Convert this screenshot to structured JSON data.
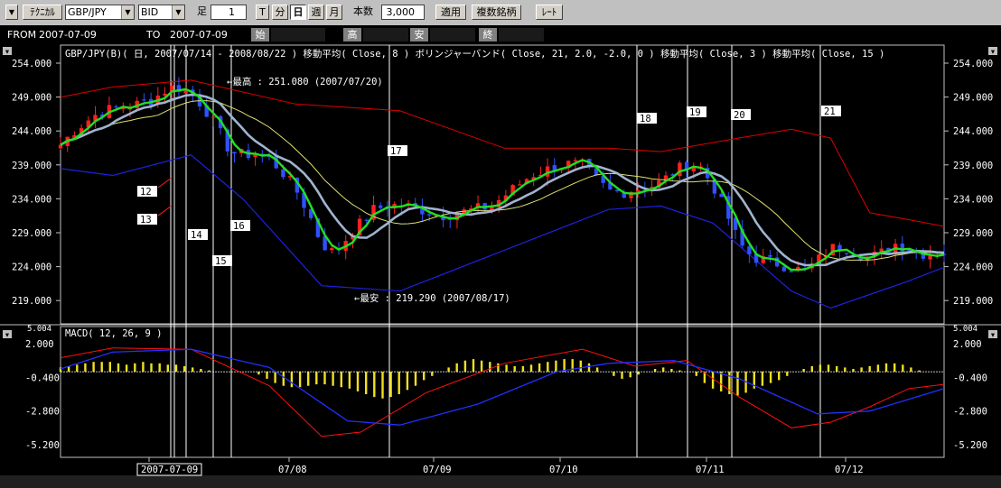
{
  "toolbar": {
    "menu_arrow": "▼",
    "technical_label": "ﾃｸﾆｶﾙ",
    "pair": "GBP/JPY",
    "price_type": "BID",
    "foot_label": "足",
    "foot_value": "1",
    "period_buttons": [
      "T",
      "分",
      "日",
      "週",
      "月"
    ],
    "active_period": "日",
    "count_label": "本数",
    "count_value": "3,000",
    "apply_label": "適用",
    "multi_label": "複数銘柄",
    "rate_label": "ﾚｰﾄ"
  },
  "infobar": {
    "from_label": "FROM",
    "from_value": "2007-07-09",
    "to_label": "TO",
    "to_value": "2007-07-09",
    "open_label": "始",
    "high_label": "高",
    "low_label": "安",
    "close_label": "終"
  },
  "price_panel": {
    "header": "GBP/JPY(B)( 日, 2007/07/14 - 2008/08/22 )   移動平均( Close, 8 )   ボリンジャーバンド( Close, 21, 2.0, -2.0, 0 )   移動平均( Close, 3 )   移動平均( Close, 15 )",
    "high_annotation": "←最高 : 251.080 (2007/07/20)",
    "low_annotation": "←最安 : 219.290 (2007/08/17)",
    "y_ticks": [
      "254.000",
      "249.000",
      "244.000",
      "239.000",
      "234.000",
      "229.000",
      "224.000",
      "219.000"
    ]
  },
  "macd_panel": {
    "header": "MACD( 12, 26, 9 )",
    "y_ticks": [
      "2.000",
      "-0.400",
      "-2.800",
      "-5.200"
    ],
    "cut_tick": "5.004"
  },
  "markers": [
    "12",
    "13",
    "14",
    "15",
    "16",
    "17",
    "18",
    "19",
    "20",
    "21"
  ],
  "x_axis": {
    "labels": [
      "2007-07-09",
      "07/08",
      "07/09",
      "07/10",
      "07/11",
      "07/12"
    ]
  },
  "colors": {
    "up": "#ff2020",
    "down": "#3050ff",
    "ma3": "#20e020",
    "ma8": "#a0b4d0",
    "ma15": "#e0e070",
    "bb_upper": "#e00000",
    "bb_lower": "#2020e0",
    "macd_hist": "#f0e020"
  },
  "chart_data": {
    "type": "candlestick",
    "title": "GBP/JPY(B)( 日, 2007/07/14 - 2008/08/22 )",
    "ylim": [
      216.5,
      256
    ],
    "indicators": [
      "移動平均( Close, 8 )",
      "ボリンジャーバンド( Close, 21, 2.0, -2.0, 0 )",
      "移動平均( Close, 3 )",
      "移動平均( Close, 15 )",
      "MACD( 12, 26, 9 )"
    ],
    "price_path": [
      [
        0,
        242.0
      ],
      [
        10,
        244.0
      ],
      [
        20,
        245.5
      ],
      [
        30,
        246.8
      ],
      [
        40,
        247.3
      ],
      [
        50,
        247.6
      ],
      [
        60,
        248.0
      ],
      [
        70,
        248.6
      ],
      [
        80,
        250.0
      ],
      [
        88,
        250.6
      ],
      [
        100,
        249.6
      ],
      [
        110,
        247.5
      ],
      [
        120,
        244.5
      ],
      [
        130,
        241.0
      ],
      [
        140,
        240.5
      ],
      [
        150,
        240.8
      ],
      [
        160,
        240.0
      ],
      [
        170,
        238.0
      ],
      [
        180,
        235.5
      ],
      [
        190,
        232.0
      ],
      [
        200,
        227.5
      ],
      [
        210,
        226.0
      ],
      [
        220,
        228.5
      ],
      [
        230,
        230.5
      ],
      [
        240,
        232.5
      ],
      [
        250,
        233.0
      ],
      [
        260,
        233.2
      ],
      [
        270,
        232.8
      ],
      [
        280,
        232.3
      ],
      [
        290,
        231.6
      ],
      [
        300,
        231.8
      ],
      [
        310,
        232.2
      ],
      [
        320,
        232.6
      ],
      [
        330,
        233.0
      ],
      [
        340,
        234.5
      ],
      [
        350,
        236.0
      ],
      [
        360,
        237.5
      ],
      [
        370,
        238.2
      ],
      [
        380,
        238.8
      ],
      [
        390,
        239.2
      ],
      [
        400,
        239.0
      ],
      [
        410,
        237.0
      ],
      [
        420,
        235.2
      ],
      [
        430,
        235.0
      ],
      [
        440,
        235.5
      ],
      [
        450,
        235.8
      ],
      [
        460,
        236.5
      ],
      [
        470,
        238.0
      ],
      [
        480,
        239.2
      ],
      [
        490,
        238.8
      ],
      [
        500,
        236.0
      ],
      [
        510,
        232.0
      ],
      [
        520,
        227.5
      ],
      [
        530,
        225.5
      ],
      [
        540,
        225.0
      ],
      [
        550,
        224.5
      ],
      [
        560,
        224.0
      ],
      [
        570,
        223.3
      ],
      [
        580,
        225.0
      ],
      [
        590,
        226.8
      ],
      [
        600,
        227.0
      ],
      [
        610,
        226.0
      ],
      [
        620,
        225.4
      ],
      [
        630,
        226.2
      ],
      [
        640,
        227.5
      ],
      [
        650,
        226.8
      ],
      [
        660,
        226.0
      ],
      [
        670,
        226.3
      ],
      [
        677,
        226.2
      ]
    ],
    "bb_upper": [
      [
        0,
        249
      ],
      [
        40,
        250.5
      ],
      [
        100,
        251.5
      ],
      [
        180,
        248
      ],
      [
        260,
        247
      ],
      [
        340,
        241.5
      ],
      [
        420,
        241.5
      ],
      [
        460,
        241
      ],
      [
        520,
        243
      ],
      [
        560,
        244.3
      ],
      [
        590,
        243
      ],
      [
        620,
        232
      ],
      [
        650,
        231
      ],
      [
        677,
        230
      ]
    ],
    "bb_lower": [
      [
        0,
        238.5
      ],
      [
        40,
        237.5
      ],
      [
        100,
        240.5
      ],
      [
        140,
        234
      ],
      [
        200,
        221.3
      ],
      [
        260,
        220.5
      ],
      [
        340,
        226.5
      ],
      [
        420,
        232.5
      ],
      [
        460,
        233
      ],
      [
        500,
        230.5
      ],
      [
        560,
        220.5
      ],
      [
        590,
        218
      ],
      [
        620,
        220
      ],
      [
        650,
        222
      ],
      [
        677,
        224
      ]
    ],
    "macd_hist": [
      0.3,
      0.4,
      0.5,
      0.6,
      0.7,
      0.7,
      0.7,
      0.6,
      0.5,
      0.6,
      0.7,
      0.6,
      0.6,
      0.5,
      0.5,
      0.4,
      0.3,
      0.2,
      0.1,
      0.0,
      0.0,
      0.0,
      0.0,
      0.0,
      -0.2,
      -0.5,
      -0.8,
      -1.0,
      -1.1,
      -1.1,
      -1.0,
      -0.9,
      -0.9,
      -1.0,
      -1.1,
      -1.2,
      -1.4,
      -1.6,
      -1.8,
      -1.9,
      -1.8,
      -1.6,
      -1.3,
      -1.0,
      -0.6,
      -0.3,
      0.0,
      0.3,
      0.6,
      0.8,
      0.9,
      0.8,
      0.7,
      0.6,
      0.5,
      0.4,
      0.4,
      0.5,
      0.6,
      0.7,
      0.8,
      0.9,
      0.9,
      0.8,
      0.6,
      0.3,
      0.0,
      -0.3,
      -0.5,
      -0.4,
      -0.2,
      0.0,
      0.2,
      0.3,
      0.2,
      0.1,
      0.0,
      -0.3,
      -0.8,
      -1.2,
      -1.4,
      -1.6,
      -1.7,
      -1.5,
      -1.2,
      -1.0,
      -0.8,
      -0.6,
      -0.3,
      0.0,
      0.2,
      0.4,
      0.5,
      0.5,
      0.4,
      0.3,
      0.2,
      0.3,
      0.4,
      0.5,
      0.6,
      0.6,
      0.5,
      0.3,
      0.1,
      0.0,
      0.0,
      0.0
    ],
    "macd_red": [
      [
        0,
        1.0
      ],
      [
        40,
        1.7
      ],
      [
        100,
        1.6
      ],
      [
        160,
        -1.0
      ],
      [
        200,
        -4.6
      ],
      [
        230,
        -4.3
      ],
      [
        280,
        -1.5
      ],
      [
        340,
        0.6
      ],
      [
        400,
        1.6
      ],
      [
        440,
        0.4
      ],
      [
        480,
        0.8
      ],
      [
        520,
        -1.8
      ],
      [
        560,
        -4.0
      ],
      [
        590,
        -3.6
      ],
      [
        620,
        -2.5
      ],
      [
        650,
        -1.2
      ],
      [
        677,
        -0.9
      ]
    ],
    "macd_blue": [
      [
        0,
        0.2
      ],
      [
        40,
        1.4
      ],
      [
        100,
        1.6
      ],
      [
        160,
        0.3
      ],
      [
        220,
        -3.5
      ],
      [
        260,
        -3.8
      ],
      [
        320,
        -2.3
      ],
      [
        380,
        0.0
      ],
      [
        420,
        0.6
      ],
      [
        470,
        0.8
      ],
      [
        520,
        -0.5
      ],
      [
        580,
        -3.0
      ],
      [
        620,
        -2.8
      ],
      [
        677,
        -1.2
      ]
    ]
  }
}
